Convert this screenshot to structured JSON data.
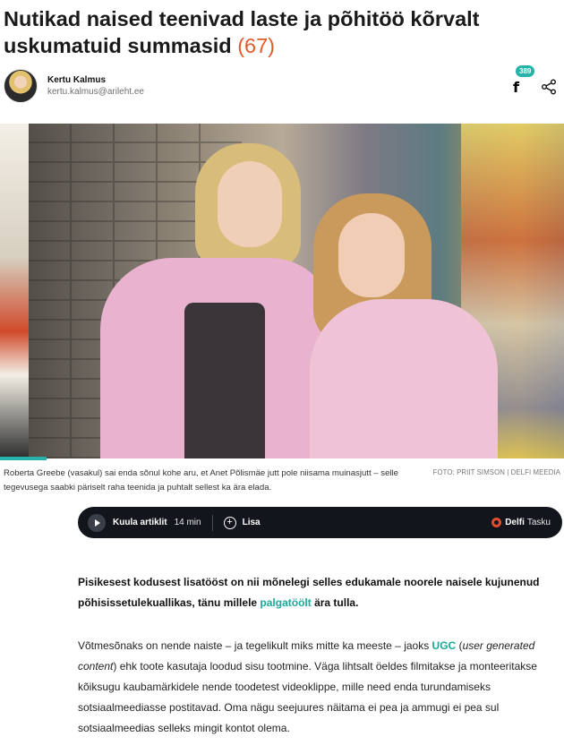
{
  "article": {
    "title": "Nutikad naised teenivad laste ja põhitöö kõrvalt uskumatuid summasid",
    "comment_count": "(67)"
  },
  "author": {
    "name": "Kertu Kalmus",
    "email": "kertu.kalmus@arileht.ee"
  },
  "share": {
    "facebook_count": "389",
    "facebook_icon": "facebook-icon",
    "share_icon": "share-icon"
  },
  "photo": {
    "caption": "Roberta Greebe (vasakul) sai enda sõnul kohe aru, et Anet Põlismäe jutt pole niisama muinasjutt – selle tegevusega saabki päriselt raha teenida ja puhtalt sellest ka ära elada.",
    "credit": "FOTO: PRIIT SIMSON | DELFI MEEDIA"
  },
  "audio_player": {
    "listen_label": "Kuula artiklit",
    "duration": "14 min",
    "add_label": "Lisa",
    "brand_main": "Delfi",
    "brand_sub": "Tasku"
  },
  "lead": {
    "text_before": "Pisikesest kodusest lisatööst on nii mõnelegi selles edukamale noorele naisele kujunenud põhisissetulekuallikas, tänu millele ",
    "link_text": "palgatöölt",
    "text_after": " ära tulla."
  },
  "body": {
    "p1_before": "Võtmesõnaks on nende naiste – ja tegelikult miks mitte ka meeste – jaoks ",
    "p1_ugc": "UGC",
    "p1_paren_open": " (",
    "p1_italic": "user generated content",
    "p1_after": ") ehk toote kasutaja loodud sisu tootmine. Väga lihtsalt öeldes filmitakse ja monteeritakse kõiksugu kaubamärkidele nende toodetest videoklippe, mille need enda turundamiseks sotsiaalmeediasse postitavad. Oma nägu seejuures näitama ei pea ja ammugi ei pea sul sotsiaalmeedias selleks mingit kontot olema."
  },
  "colors": {
    "accent": "#27b3a7",
    "link": "#1ba89b",
    "comment_count": "#e35a2a",
    "player_bg": "#12151c"
  }
}
